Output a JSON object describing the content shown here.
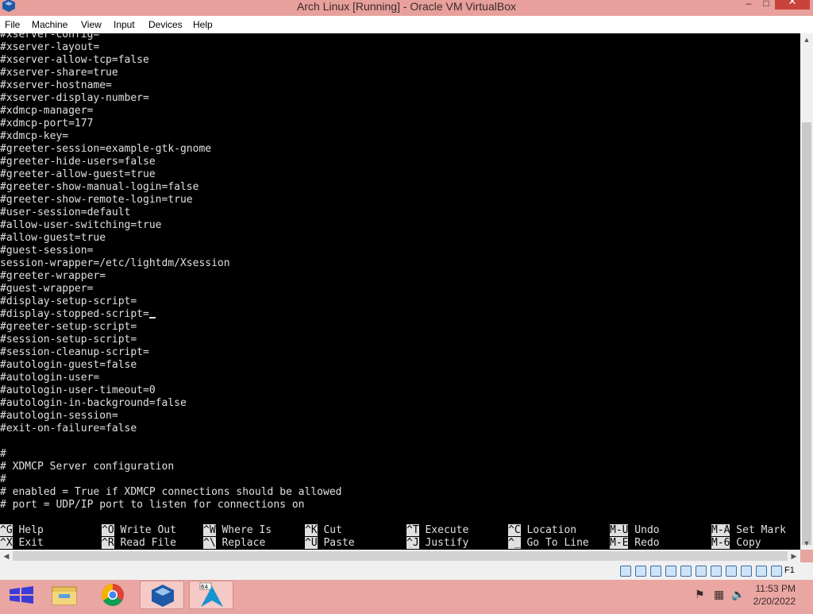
{
  "window": {
    "title": "Arch Linux [Running] - Oracle VM VirtualBox",
    "minimize": "–",
    "maximize": "□",
    "close": "✕"
  },
  "menu": [
    "File",
    "Machine",
    "View",
    "Input",
    "Devices",
    "Help"
  ],
  "terminal": {
    "lines": [
      "#xserver-config=",
      "#xserver-layout=",
      "#xserver-allow-tcp=false",
      "#xserver-share=true",
      "#xserver-hostname=",
      "#xserver-display-number=",
      "#xdmcp-manager=",
      "#xdmcp-port=177",
      "#xdmcp-key=",
      "#greeter-session=example-gtk-gnome",
      "#greeter-hide-users=false",
      "#greeter-allow-guest=true",
      "#greeter-show-manual-login=false",
      "#greeter-show-remote-login=true",
      "#user-session=default",
      "#allow-user-switching=true",
      "#allow-guest=true",
      "#guest-session=",
      "session-wrapper=/etc/lightdm/Xsession",
      "#greeter-wrapper=",
      "#guest-wrapper=",
      "#display-setup-script=",
      "#display-stopped-script=",
      "#greeter-setup-script=",
      "#session-setup-script=",
      "#session-cleanup-script=",
      "#autologin-guest=false",
      "#autologin-user=",
      "#autologin-user-timeout=0",
      "#autologin-in-background=false",
      "#autologin-session=",
      "#exit-on-failure=false",
      "",
      "#",
      "# XDMCP Server configuration",
      "#",
      "# enabled = True if XDMCP connections should be allowed",
      "# port = UDP/IP port to listen for connections on"
    ],
    "shortcuts_row1": [
      {
        "key": "^G",
        "label": "Help"
      },
      {
        "key": "^O",
        "label": "Write Out"
      },
      {
        "key": "^W",
        "label": "Where Is"
      },
      {
        "key": "^K",
        "label": "Cut"
      },
      {
        "key": "^T",
        "label": "Execute"
      },
      {
        "key": "^C",
        "label": "Location"
      },
      {
        "key": "M-U",
        "label": "Undo"
      },
      {
        "key": "M-A",
        "label": "Set Mark"
      }
    ],
    "shortcuts_row2": [
      {
        "key": "^X",
        "label": "Exit"
      },
      {
        "key": "^R",
        "label": "Read File"
      },
      {
        "key": "^\\",
        "label": "Replace"
      },
      {
        "key": "^U",
        "label": "Paste"
      },
      {
        "key": "^J",
        "label": "Justify"
      },
      {
        "key": "^_",
        "label": "Go To Line"
      },
      {
        "key": "M-E",
        "label": "Redo"
      },
      {
        "key": "M-6",
        "label": "Copy"
      }
    ]
  },
  "statusbar": {
    "icons": [
      "hard-disk-icon",
      "optical-drive-icon",
      "audio-icon",
      "network-icon",
      "usb-icon",
      "shared-folder-icon",
      "display-icon",
      "video-capture-icon",
      "cpu-icon",
      "mouse-integration-icon",
      "arrow-icon"
    ],
    "host_key": "F1"
  },
  "taskbar": {
    "apps": [
      "start-icon",
      "file-explorer-icon",
      "chrome-icon",
      "virtualbox-icon",
      "arch-linux-icon"
    ],
    "time": "11:53 PM",
    "date": "2/20/2022"
  }
}
